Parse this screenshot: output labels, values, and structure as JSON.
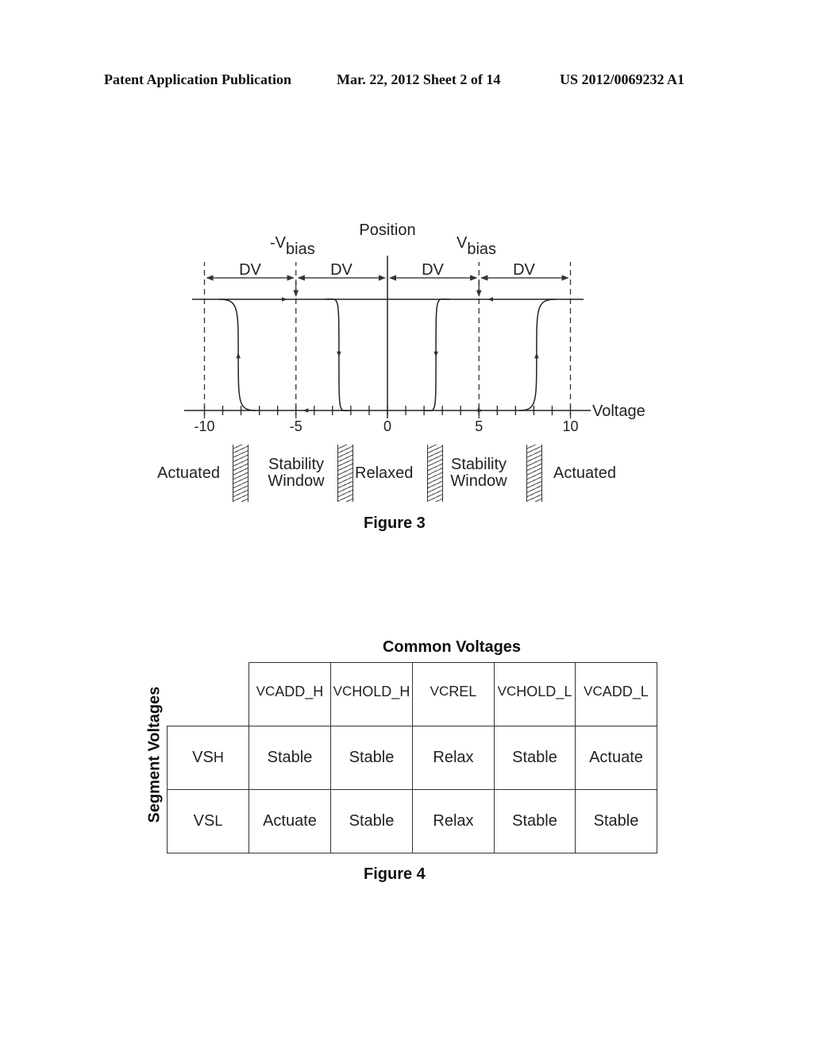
{
  "header": {
    "publication": "Patent Application Publication",
    "date_sheet": "Mar. 22, 2012  Sheet 2 of 14",
    "number": "US 2012/0069232 A1"
  },
  "figure3": {
    "caption": "Figure 3",
    "y_axis_label": "Position",
    "x_axis_label": "Voltage",
    "neg_bias_label": {
      "main": "-V",
      "sub": "bias"
    },
    "pos_bias_label": {
      "main": "V",
      "sub": "bias"
    },
    "dv_labels": [
      "DV",
      "DV",
      "DV",
      "DV"
    ],
    "regions": [
      {
        "line1": "Actuated",
        "line2": ""
      },
      {
        "line1": "Stability",
        "line2": "Window"
      },
      {
        "line1": "Relaxed",
        "line2": ""
      },
      {
        "line1": "Stability",
        "line2": "Window"
      },
      {
        "line1": "Actuated",
        "line2": ""
      }
    ],
    "chart_data": {
      "type": "line",
      "title": "",
      "xlabel": "Voltage",
      "ylabel": "Position",
      "xlim": [
        -10.5,
        11
      ],
      "ylim": [
        0,
        1
      ],
      "tick_labels": [
        "-10",
        "-5",
        "0",
        "5",
        "10"
      ],
      "tick_values": [
        -10,
        -5,
        0,
        5,
        10
      ],
      "minor_ticks": [
        -9,
        -8,
        -7,
        -6,
        -4,
        -3,
        -2,
        -1,
        1,
        2,
        3,
        4,
        6,
        7,
        8,
        9
      ],
      "dashed_verticals": [
        -10,
        -5,
        5,
        10
      ],
      "vbias": 5,
      "dv": 5,
      "series": [
        {
          "name": "negative-actuation-branch",
          "direction": "up",
          "points": [
            [
              -7.2,
              0
            ],
            [
              -8.0,
              0.4
            ],
            [
              -8.3,
              0.75
            ],
            [
              -9.2,
              1
            ]
          ]
        },
        {
          "name": "negative-release-branch",
          "direction": "down",
          "points": [
            [
              -3.4,
              1
            ],
            [
              -2.8,
              0.7
            ],
            [
              -2.5,
              0.3
            ],
            [
              -2.0,
              0
            ]
          ]
        },
        {
          "name": "positive-release-branch",
          "direction": "down",
          "points": [
            [
              3.4,
              1
            ],
            [
              2.8,
              0.7
            ],
            [
              2.5,
              0.3
            ],
            [
              2.0,
              0
            ]
          ]
        },
        {
          "name": "positive-actuation-branch",
          "direction": "up",
          "points": [
            [
              7.2,
              0
            ],
            [
              8.0,
              0.4
            ],
            [
              8.3,
              0.75
            ],
            [
              9.2,
              1
            ]
          ]
        }
      ]
    }
  },
  "figure4": {
    "caption": "Figure 4",
    "column_group_title": "Common Voltages",
    "row_group_title": "Segment Voltages",
    "columns": [
      {
        "main": "VC",
        "sub": "ADD_H"
      },
      {
        "main": "VC",
        "sub": "HOLD_H"
      },
      {
        "main": "VC",
        "sub": "REL"
      },
      {
        "main": "VC",
        "sub": "HOLD_L"
      },
      {
        "main": "VC",
        "sub": "ADD_L"
      }
    ],
    "rows": [
      {
        "label": {
          "main": "VS",
          "sub": "H"
        },
        "cells": [
          "Stable",
          "Stable",
          "Relax",
          "Stable",
          "Actuate"
        ]
      },
      {
        "label": {
          "main": "VS",
          "sub": "L"
        },
        "cells": [
          "Actuate",
          "Stable",
          "Relax",
          "Stable",
          "Stable"
        ]
      }
    ]
  }
}
